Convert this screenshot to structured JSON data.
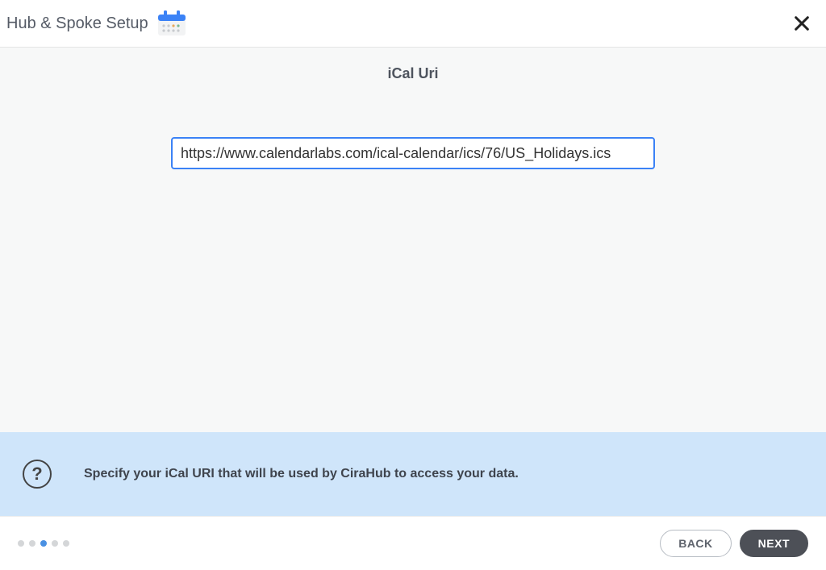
{
  "header": {
    "title": "Hub & Spoke Setup"
  },
  "section": {
    "title": "iCal Uri"
  },
  "input": {
    "value": "https://www.calendarlabs.com/ical-calendar/ics/76/US_Holidays.ics",
    "placeholder": ""
  },
  "help": {
    "icon_text": "?",
    "text": "Specify your iCal URI that will be used by CiraHub to access your data."
  },
  "progress": {
    "total_steps": 5,
    "current_step": 3
  },
  "footer": {
    "back_label": "BACK",
    "next_label": "NEXT"
  }
}
